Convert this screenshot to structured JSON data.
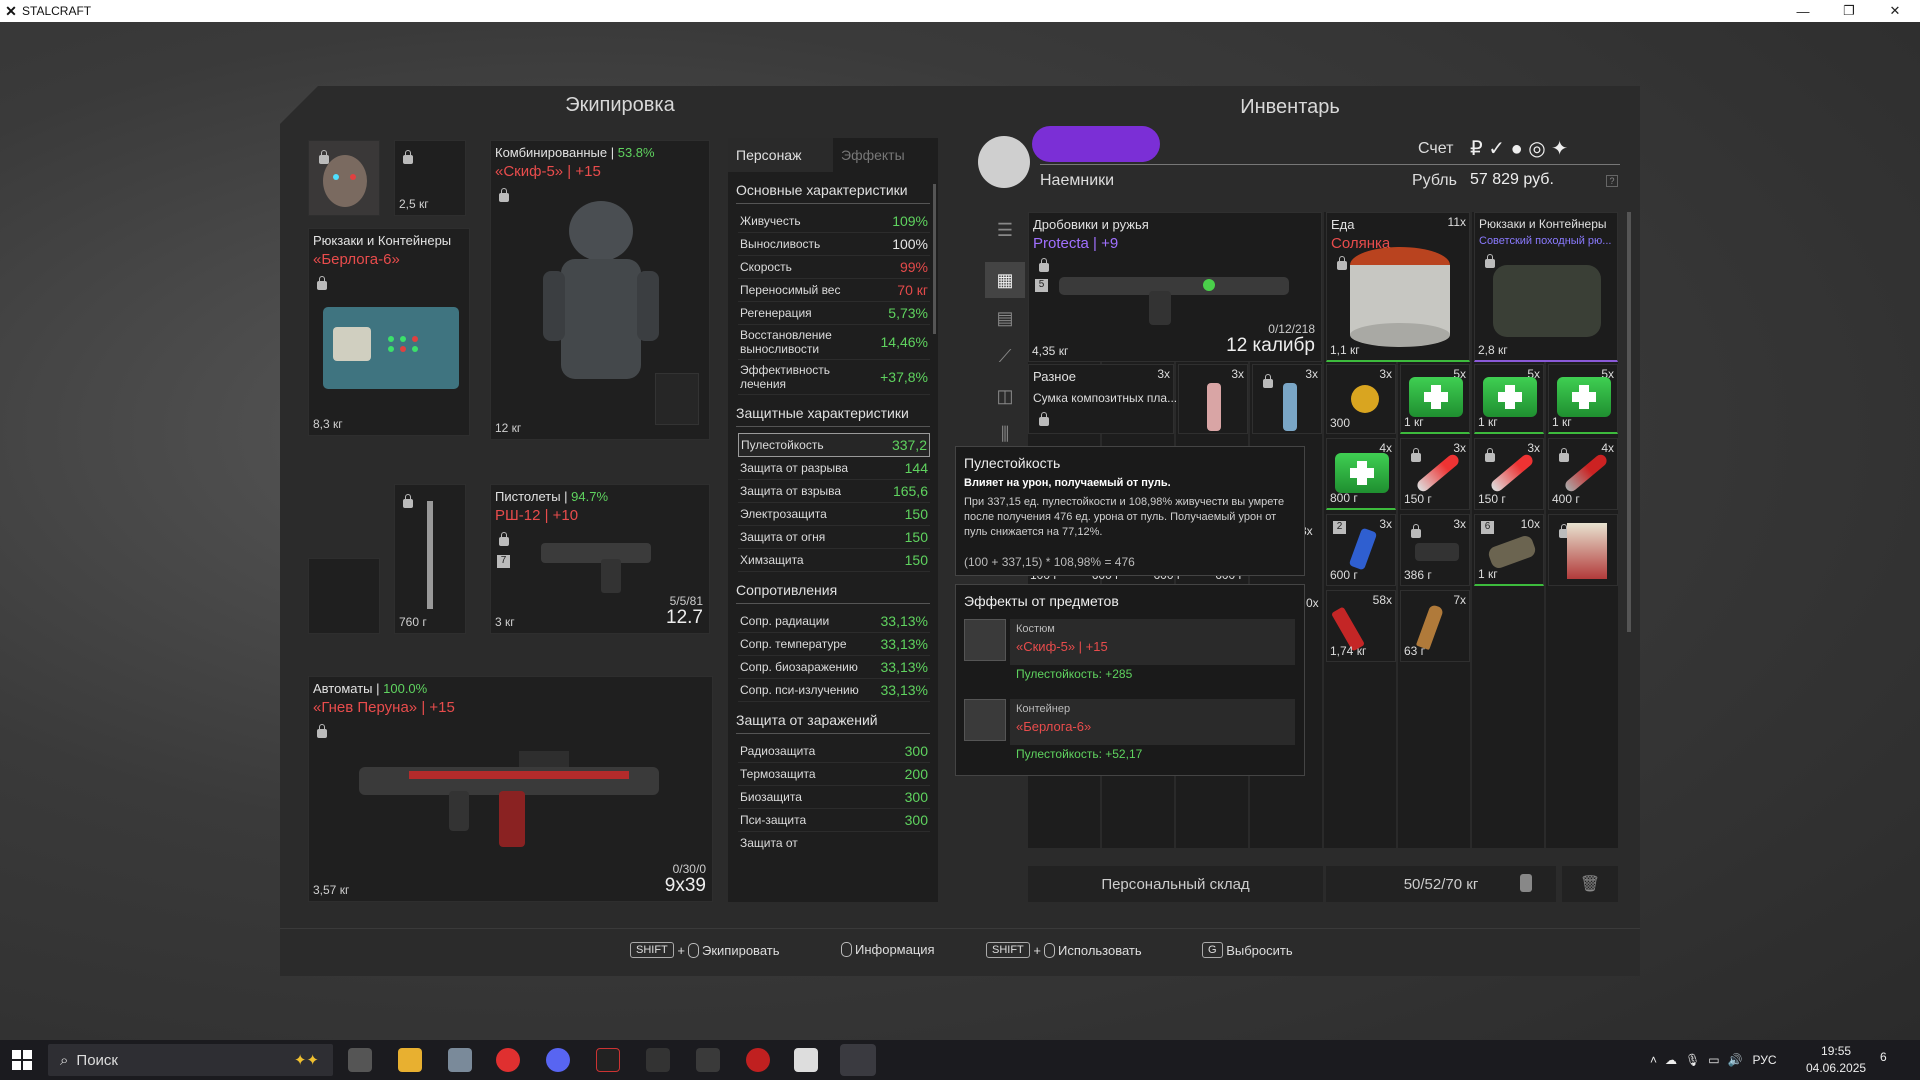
{
  "window": {
    "title": "STALCRAFT",
    "minimize": "—",
    "maximize": "❐",
    "close": "✕"
  },
  "equipment": {
    "title": "Экипировка",
    "head_weight": "2,5 кг",
    "backpack": {
      "category": "Рюкзаки и Контейнеры",
      "name": "«Берлога-6»",
      "weight": "8,3 кг"
    },
    "armor": {
      "category": "Комбинированные | ",
      "percent": "53.8%",
      "name": "«Скиф-5» | +15",
      "weight": "12 кг"
    },
    "melee": {
      "weight": "760 г"
    },
    "pistol": {
      "category": "Пистолеты | ",
      "percent": "94.7%",
      "name": "РШ-12 | +10",
      "weight": "3 кг",
      "ammo": "5/5/81",
      "caliber": "12.7",
      "badge": "7"
    },
    "rifle": {
      "category": "Автоматы | ",
      "percent": "100.0%",
      "name": "«Гнев Перуна» | +15",
      "weight": "3,57 кг",
      "ammo": "0/30/0",
      "caliber": "9x39"
    }
  },
  "stats": {
    "tab_character": "Персонаж",
    "tab_effects": "Эффекты",
    "basic_title": "Основные характеристики",
    "basic": [
      {
        "label": "Живучесть",
        "value": "109%",
        "color": "g"
      },
      {
        "label": "Выносливость",
        "value": "100%",
        "color": "w"
      },
      {
        "label": "Скорость",
        "value": "99%",
        "color": "r"
      },
      {
        "label": "Переносимый вес",
        "value": "70 кг",
        "color": "r"
      },
      {
        "label": "Регенерация",
        "value": "5,73%",
        "color": "g"
      },
      {
        "label": "Восстановление выносливости",
        "value": "14,46%",
        "color": "g"
      },
      {
        "label": "Эффективность лечения",
        "value": "+37,8%",
        "color": "g"
      }
    ],
    "protect_title": "Защитные характеристики",
    "protect": [
      {
        "label": "Пулестойкость",
        "value": "337,2",
        "color": "g"
      },
      {
        "label": "Защита от разрыва",
        "value": "144",
        "color": "g"
      },
      {
        "label": "Защита от взрыва",
        "value": "165,6",
        "color": "g"
      },
      {
        "label": "Электрозащита",
        "value": "150",
        "color": "g"
      },
      {
        "label": "Защита от огня",
        "value": "150",
        "color": "g"
      },
      {
        "label": "Химзащита",
        "value": "150",
        "color": "g"
      }
    ],
    "resist_title": "Сопротивления",
    "resist": [
      {
        "label": "Сопр. радиации",
        "value": "33,13%",
        "color": "g"
      },
      {
        "label": "Сопр. температуре",
        "value": "33,13%",
        "color": "g"
      },
      {
        "label": "Сопр. биозаражению",
        "value": "33,13%",
        "color": "g"
      },
      {
        "label": "Сопр. пси-излучению",
        "value": "33,13%",
        "color": "g"
      }
    ],
    "infect_title": "Защита от заражений",
    "infect": [
      {
        "label": "Радиозащита",
        "value": "300",
        "color": "g"
      },
      {
        "label": "Термозащита",
        "value": "200",
        "color": "g"
      },
      {
        "label": "Биозащита",
        "value": "300",
        "color": "g"
      },
      {
        "label": "Пси-защита",
        "value": "300",
        "color": "g"
      }
    ],
    "cut_row": "Защита от"
  },
  "inventory": {
    "title": "Инвентарь",
    "faction": "Наемники",
    "account_label": "Счет",
    "currency_label": "Рубль",
    "balance": "57 829 руб.",
    "help": "?",
    "shotgun": {
      "category": "Дробовики и ружья",
      "name": "Protecta | +9",
      "weight": "4,35 кг",
      "ammo": "0/12/218",
      "caliber": "12 калибр",
      "badge": "5"
    },
    "food": {
      "category": "Еда",
      "name": "Солянка",
      "count": "11x",
      "weight": "1,1 кг"
    },
    "pack": {
      "category": "Рюкзаки и Контейнеры",
      "name": "Советский походный рю...",
      "weight": "2,8 кг"
    },
    "misc": {
      "category": "Разное",
      "name": "Сумка композитных пла...",
      "count": "3x"
    },
    "row2": [
      {
        "count": "3x"
      },
      {
        "count": "3x"
      },
      {
        "count": "3x",
        "weight": "300"
      },
      {
        "count": "5x",
        "weight": "1 кг"
      },
      {
        "count": "5x",
        "weight": "1 кг"
      },
      {
        "count": "5x",
        "weight": "1 кг"
      }
    ],
    "row3": [
      {
        "count": "4x",
        "weight": "800 г"
      },
      {
        "count": "3x",
        "weight": "150 г"
      },
      {
        "count": "3x",
        "weight": "150 г"
      },
      {
        "count": "4x",
        "weight": "400 г"
      }
    ],
    "row4": [
      {
        "count": "3x",
        "weight": "600 г",
        "badge": "2"
      },
      {
        "count": "3x",
        "weight": "386 г"
      },
      {
        "count": "10x",
        "weight": "1 кг",
        "badge": "6"
      },
      {
        "count": "",
        "weight": ""
      }
    ],
    "row5": [
      {
        "count": "58x",
        "weight": "1,74 кг"
      },
      {
        "count": "7x",
        "weight": "63 г"
      }
    ],
    "hidden_weights": [
      "100 г",
      "600 г",
      "600 г",
      "600 г"
    ],
    "hidden_count": "0x",
    "hidden_count2": "3x",
    "storage_label": "Персональный склад",
    "storage_weight": "50/52/70 кг"
  },
  "tooltip": {
    "title": "Пулестойкость",
    "subtitle": "Влияет на урон, получаемый от пуль.",
    "body": "При 337,15 ед. пулестойкости и 108,98% живучести вы умрете после получения 476 ед. урона от пуль. Получаемый урон от пуль снижается на 77,12%.",
    "formula": "(100 + 337,15) * 108,98% = 476"
  },
  "effects": {
    "title": "Эффекты от предметов",
    "items": [
      {
        "type": "Костюм",
        "name": "«Скиф-5» | +15",
        "bonus": "Пулестойкость: +285"
      },
      {
        "type": "Контейнер",
        "name": "«Берлога-6»",
        "bonus": "Пулестойкость: +52,17"
      }
    ]
  },
  "hints": {
    "shift": "SHIFT",
    "plus": "+",
    "equip": "Экипировать",
    "info": "Информация",
    "use": "Использовать",
    "drop_key": "G",
    "drop": "Выбросить"
  },
  "taskbar": {
    "search": "Поиск",
    "lang": "РУС",
    "time": "19:55",
    "date": "04.06.2025",
    "notif": "6"
  },
  "colors": {
    "accent_green": "#5fd35f",
    "accent_red": "#e84c4c",
    "panel": "#2b2b2b",
    "purple": "#8a5ad8"
  }
}
